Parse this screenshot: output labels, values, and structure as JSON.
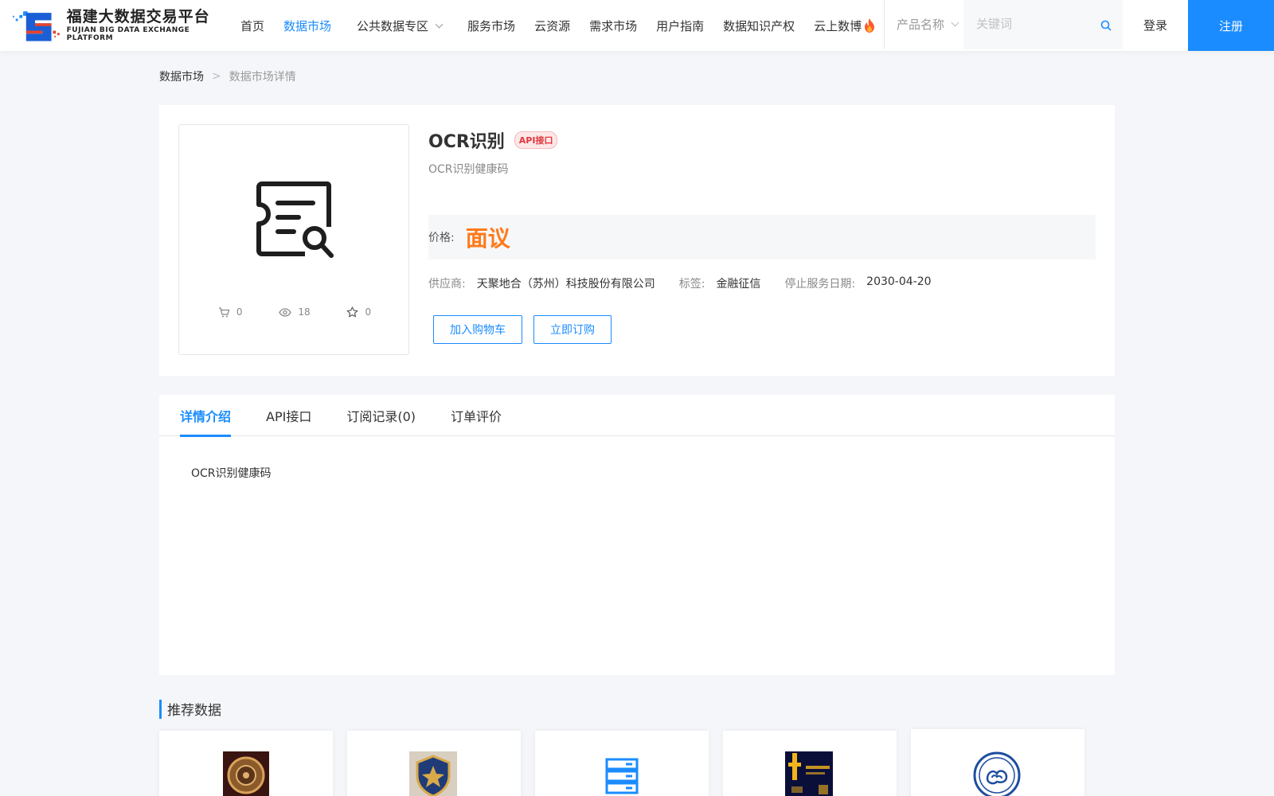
{
  "brand": {
    "name_cn": "福建大数据交易平台",
    "name_en": "FUJIAN BIG DATA EXCHANGE  PLATFORM"
  },
  "nav": {
    "items": [
      {
        "label": "首页"
      },
      {
        "label": "数据市场",
        "active": true
      },
      {
        "label": "公共数据专区",
        "dropdown": true
      },
      {
        "label": "服务市场"
      },
      {
        "label": "云资源"
      },
      {
        "label": "需求市场"
      },
      {
        "label": "用户指南"
      },
      {
        "label": "数据知识产权"
      },
      {
        "label": "云上数博",
        "icon": "flame-icon"
      }
    ]
  },
  "search": {
    "category": "产品名称",
    "placeholder": "关键词"
  },
  "auth": {
    "login": "登录",
    "register": "注册"
  },
  "breadcrumb": {
    "home": "数据市场",
    "separator": ">",
    "current": "数据市场详情"
  },
  "product": {
    "title": "OCR识别",
    "badge": "API接口",
    "subtitle": "OCR识别健康码",
    "price_label": "价格:",
    "price_value": "面议",
    "supplier_label": "供应商:",
    "supplier": "天聚地合（苏州）科技股份有限公司",
    "tag_label": "标签:",
    "tag": "金融征信",
    "end_date_label": "停止服务日期:",
    "end_date": "2030-04-20",
    "stats": {
      "cart": "0",
      "views": "18",
      "favorites": "0"
    },
    "buttons": {
      "add_to_cart": "加入购物车",
      "subscribe": "立即订购"
    }
  },
  "tabs": [
    {
      "label": "详情介绍",
      "active": true
    },
    {
      "label": "API接口"
    },
    {
      "label": "订阅记录(0)"
    },
    {
      "label": "订单评价"
    }
  ],
  "detail": {
    "text": "OCR识别健康码"
  },
  "recommended": {
    "heading": "推荐数据",
    "cards": [
      {
        "icon": "bronze-coin-icon"
      },
      {
        "icon": "shield-emblem-icon"
      },
      {
        "icon": "server-icon"
      },
      {
        "icon": "dark-logo-icon"
      },
      {
        "icon": "weather-seal-icon"
      }
    ]
  },
  "colors": {
    "accent": "#1a8cff",
    "price": "#ff7a1a",
    "badge": "#e0393e"
  }
}
